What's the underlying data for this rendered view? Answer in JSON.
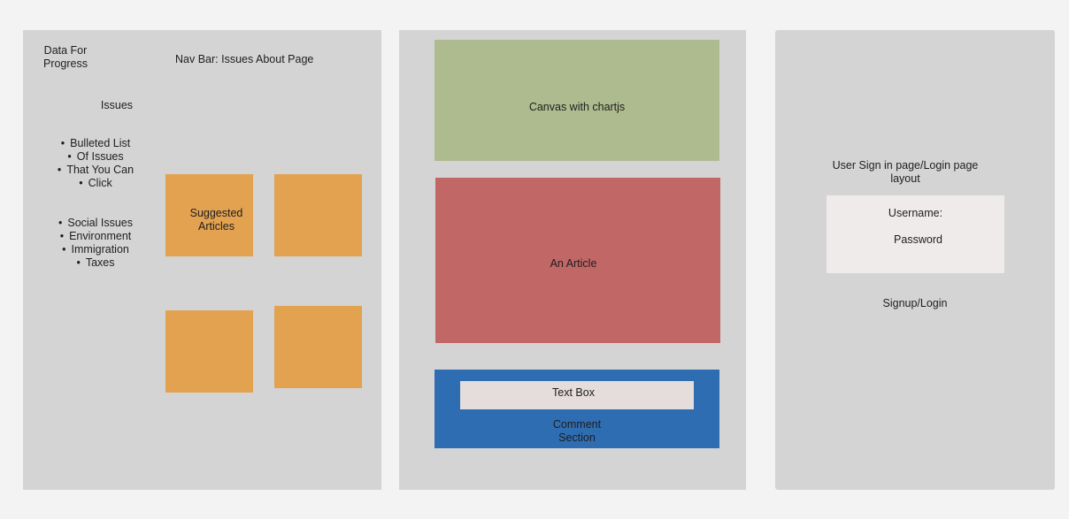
{
  "colors": {
    "background": "#f3f3f3",
    "frame": "#d4d4d4",
    "suggested_article": "#e2a250",
    "canvas_block": "#aebb8f",
    "article_block": "#c16766",
    "comment_block": "#2f6db3",
    "text_box": "#e5dcdc",
    "login_box": "#efebeb"
  },
  "issues_page": {
    "logo_lines": [
      "Data For",
      "Progress"
    ],
    "nav_bar": "Nav Bar: Issues About Page",
    "issues_heading": "Issues",
    "bullets_intro": [
      "Bulleted List",
      "Of Issues",
      "That You Can",
      "Click"
    ],
    "bullets_topics": [
      "Social Issues",
      "Environment",
      "Immigration",
      "Taxes"
    ],
    "suggested_lines": [
      "Suggested",
      "Articles"
    ]
  },
  "article_page": {
    "canvas_label": "Canvas with chartjs",
    "article_label": "An Article",
    "text_box_label": "Text Box",
    "comment_lines": [
      "Comment",
      "Section"
    ]
  },
  "login_page": {
    "title_lines": [
      "User Sign in page/Login page",
      "layout"
    ],
    "username_label": "Username:",
    "password_label": "Password",
    "submit_label": "Signup/Login"
  }
}
